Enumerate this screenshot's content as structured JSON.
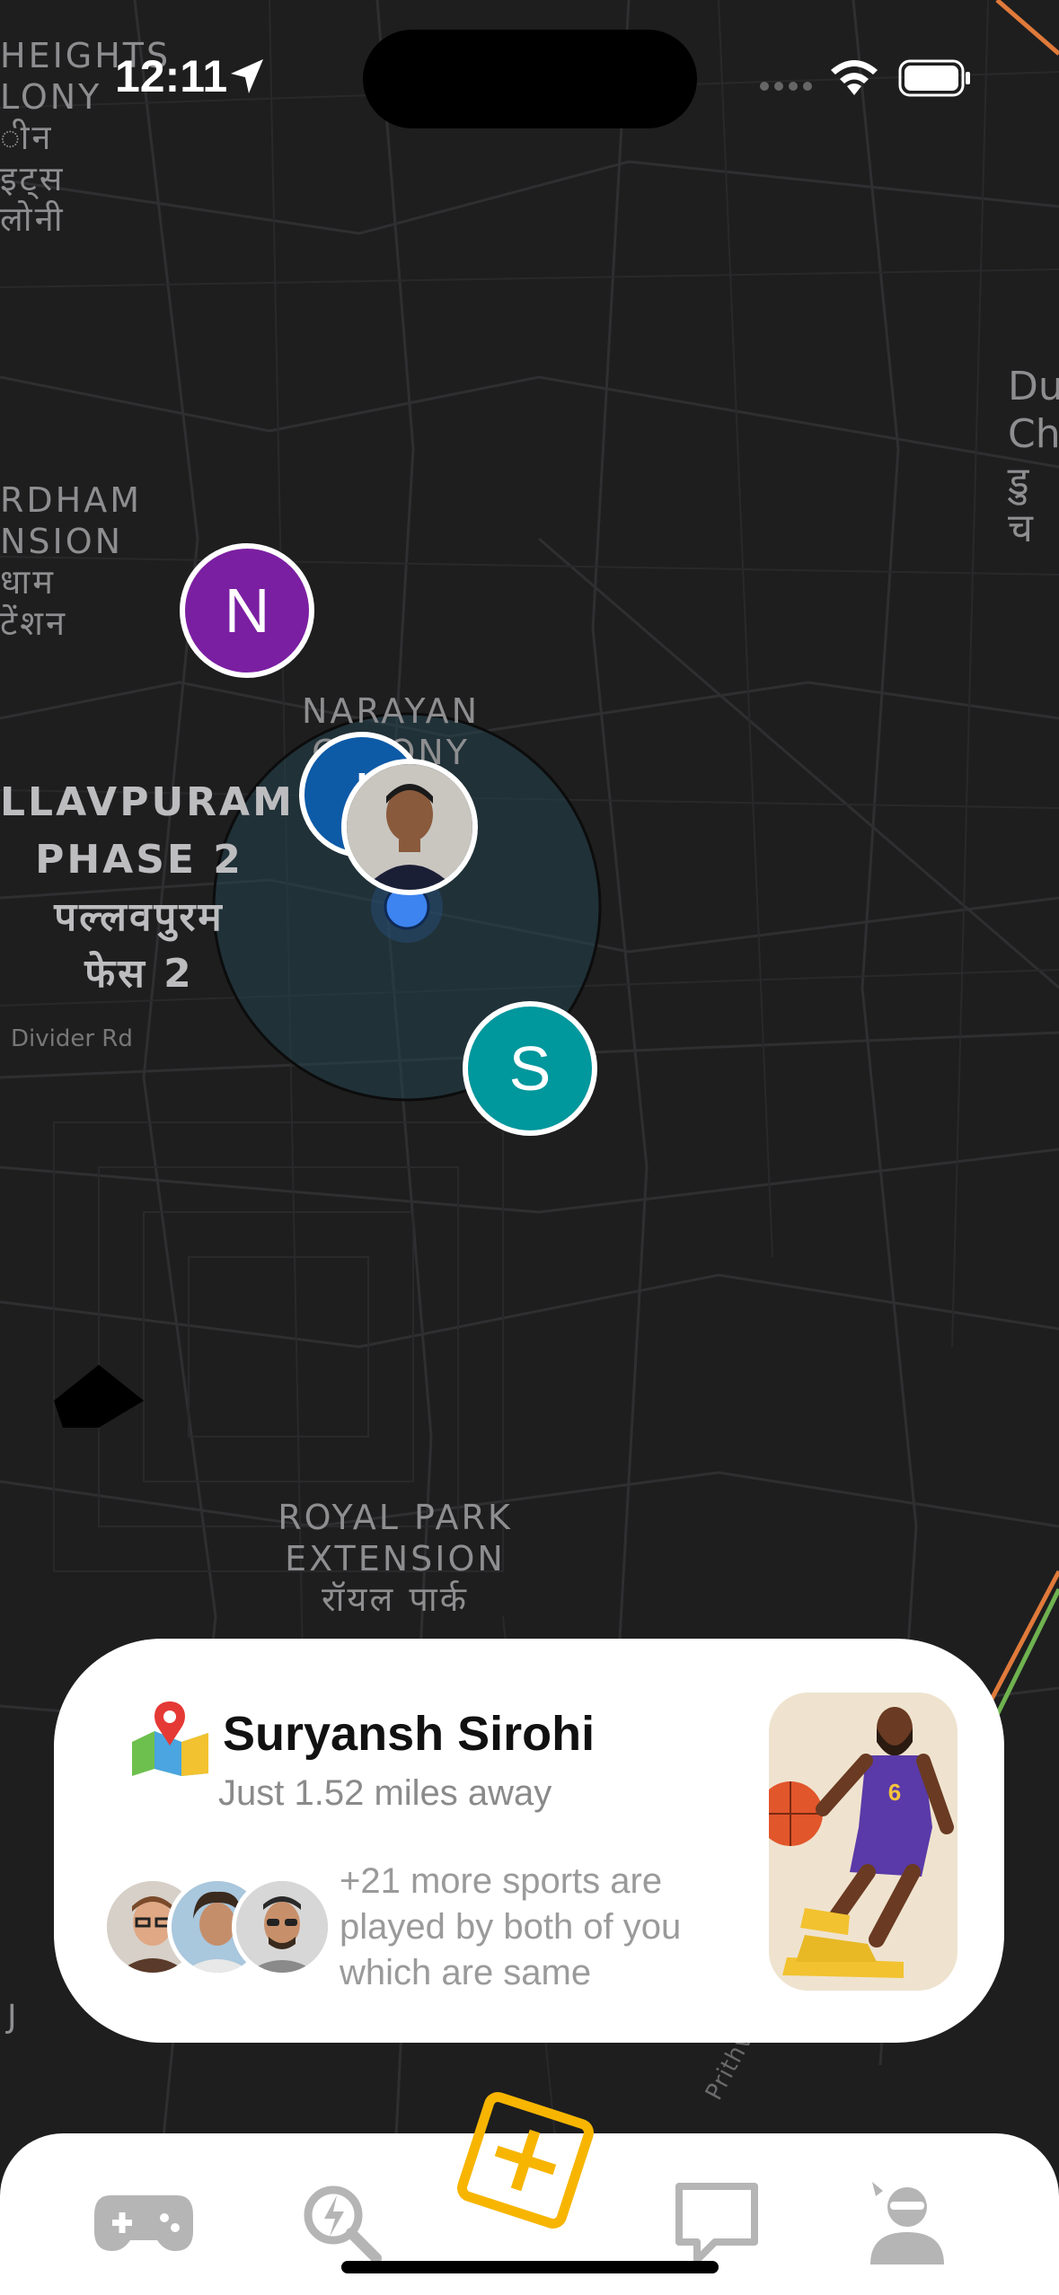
{
  "status_bar": {
    "time": "12:11"
  },
  "map": {
    "labels": [
      {
        "key": "heights",
        "text": "HEIGHTS\nLONY\nीन\nइट्स\nलोनी"
      },
      {
        "key": "du",
        "text": "Du\nCh\nडु\nच"
      },
      {
        "key": "rdham",
        "text": "RDHAM\nNSION\nधाम\nटेंशन"
      },
      {
        "key": "narayan",
        "text": "NARAYAN\nCOLONY"
      },
      {
        "key": "pallavpuram",
        "text": "LLAVPURAM\nPHASE 2\nपल्लवपुरम\nफेस 2"
      },
      {
        "key": "divider",
        "text": "Divider Rd"
      },
      {
        "key": "royalpark",
        "text": "ROYAL PARK\nEXTENSION\nरॉयल पार्क"
      },
      {
        "key": "j",
        "text": "J"
      },
      {
        "key": "prithviraj",
        "text": "Prithviraj G"
      }
    ],
    "markers": [
      {
        "key": "n",
        "letter": "N",
        "color": "#7b1fa2"
      },
      {
        "key": "h",
        "letter": "I",
        "color": "#0d5aa7"
      },
      {
        "key": "s",
        "letter": "S",
        "color": "#00979d"
      }
    ]
  },
  "card": {
    "name": "Suryansh Sirohi",
    "distance": "Just 1.52 miles away",
    "sports_text": "+21 more sports are played by both of you which are same"
  },
  "tab_bar": {
    "items": [
      {
        "key": "games",
        "icon": "gamepad-icon"
      },
      {
        "key": "explore",
        "icon": "search-bolt-icon"
      },
      {
        "key": "add",
        "icon": "plus-square-icon",
        "color": "#f7b500"
      },
      {
        "key": "chat",
        "icon": "chat-bubble-icon"
      },
      {
        "key": "profile",
        "icon": "user-icon"
      }
    ]
  }
}
